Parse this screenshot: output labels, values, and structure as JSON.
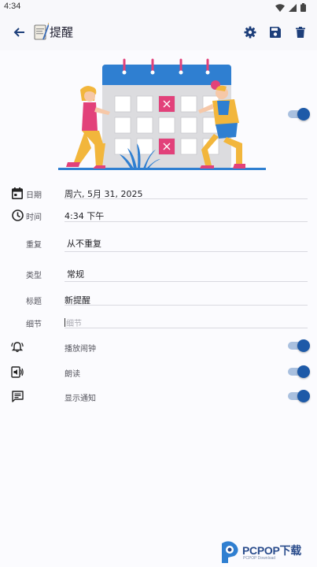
{
  "status_bar": {
    "time": "4:34"
  },
  "app_bar": {
    "title": "提醒",
    "back_icon": "arrow-back-icon",
    "settings_icon": "gear-icon",
    "save_icon": "save-icon",
    "delete_icon": "trash-icon"
  },
  "enabled_toggle": {
    "on": true
  },
  "fields": {
    "date": {
      "label": "日期",
      "value": "周六, 5月 31, 2025",
      "icon": "calendar-icon"
    },
    "time": {
      "label": "时间",
      "value": "4:34 下午",
      "icon": "clock-icon"
    },
    "repeat": {
      "label": "重复",
      "value": "从不重复"
    },
    "type": {
      "label": "类型",
      "value": "常规"
    },
    "title": {
      "label": "标题",
      "value": "新提醒"
    },
    "details": {
      "label": "细节",
      "placeholder": "细节"
    }
  },
  "options": [
    {
      "label": "播放闹钟",
      "icon": "alarm-bell-icon",
      "on": true
    },
    {
      "label": "朗读",
      "icon": "speaker-icon",
      "on": true
    },
    {
      "label": "显示通知",
      "icon": "notification-icon",
      "on": true
    }
  ],
  "watermark": {
    "text": "PCPOP下载",
    "subtext": "PCPOP Download"
  },
  "colors": {
    "accent": "#1e5aa8",
    "accent_track": "#a9c0df",
    "illustration_pink": "#e2417a",
    "illustration_blue": "#2f7fd1"
  }
}
